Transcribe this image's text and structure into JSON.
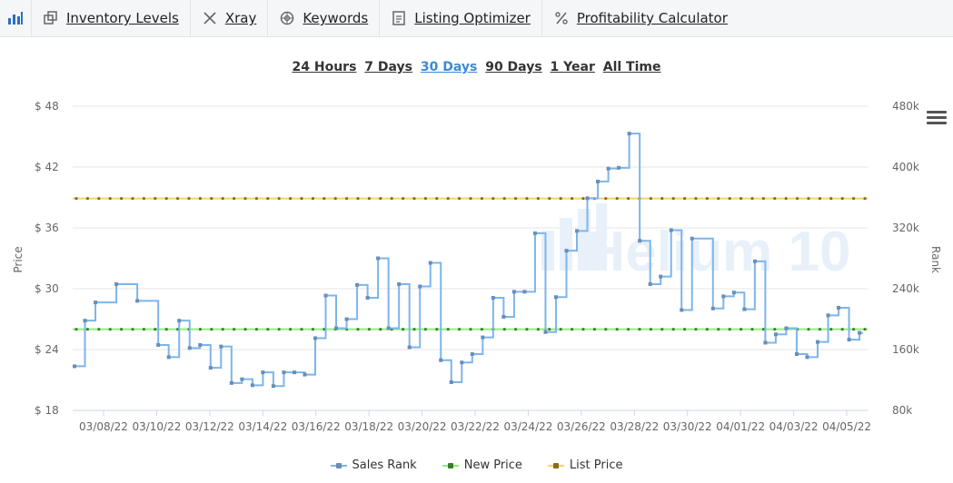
{
  "toolbar": {
    "items": [
      {
        "label": "Inventory Levels",
        "icon": "inventory-icon"
      },
      {
        "label": "Xray",
        "icon": "xray-icon"
      },
      {
        "label": "Keywords",
        "icon": "keywords-icon"
      },
      {
        "label": "Listing Optimizer",
        "icon": "listing-icon"
      },
      {
        "label": "Profitability Calculator",
        "icon": "percent-icon"
      }
    ]
  },
  "ranges": {
    "items": [
      "24 Hours",
      "7 Days",
      "30 Days",
      "90 Days",
      "1 Year",
      "All Time"
    ],
    "active": "30 Days"
  },
  "watermark": "Helium 10",
  "chart_data": {
    "type": "line",
    "y_left": {
      "label": "Price",
      "ticks": [
        "$ 18",
        "$ 24",
        "$ 30",
        "$ 36",
        "$ 42",
        "$ 48"
      ],
      "range": [
        18,
        48
      ]
    },
    "y_right": {
      "label": "Rank",
      "ticks": [
        "80k",
        "160k",
        "240k",
        "320k",
        "400k",
        "480k"
      ],
      "range": [
        80000,
        480000
      ]
    },
    "x_ticks": [
      "03/08/22",
      "03/10/22",
      "03/12/22",
      "03/14/22",
      "03/16/22",
      "03/18/22",
      "03/20/22",
      "03/22/22",
      "03/24/22",
      "03/26/22",
      "03/28/22",
      "03/30/22",
      "04/01/22",
      "04/03/22",
      "04/05/22"
    ],
    "x_range": [
      0,
      30
    ],
    "series": [
      {
        "name": "Sales Rank",
        "axis": "right",
        "step": true,
        "color": "#7cb5ec",
        "x": [
          0,
          0.5,
          1,
          2,
          3,
          4,
          4.5,
          5,
          5.5,
          6,
          6.5,
          7,
          7.5,
          8,
          8.5,
          9,
          9.5,
          10,
          10.5,
          11,
          11.5,
          12,
          12.5,
          13,
          13.5,
          14,
          14.5,
          15,
          15.5,
          16,
          16.5,
          17,
          17.5,
          18,
          18.5,
          19,
          19.5,
          20,
          20.5,
          21,
          21.5,
          22,
          22.5,
          23,
          23.5,
          24,
          24.5,
          25,
          25.5,
          26,
          26.5,
          27,
          27.5,
          28,
          28.5,
          29,
          29.5
        ],
        "values": [
          138000,
          198000,
          222000,
          246000,
          224000,
          166000,
          150000,
          198000,
          162000,
          166000,
          136000,
          164000,
          116000,
          121000,
          113000,
          130000,
          112000,
          130000,
          130000,
          127000,
          175000,
          231000,
          188000,
          200000,
          245000,
          228000,
          280000,
          188000,
          246000,
          163000,
          243000,
          274000,
          146000,
          117000,
          143000,
          154000,
          176000,
          228000,
          203000,
          236000,
          236000,
          313000,
          183000,
          229000,
          290000,
          316000,
          359000,
          381000,
          398000,
          399000,
          444000,
          303000,
          246000,
          256000,
          317000,
          212000,
          306000
        ],
        "values_tail": [
          214000,
          230000,
          235000,
          213000,
          276000,
          169000,
          180000,
          188000,
          154000,
          150000,
          170000,
          205000,
          215000,
          173000,
          182000
        ],
        "x_tail": [
          30.5,
          31,
          31.5,
          32,
          32.5,
          33,
          33.5,
          34,
          34.5,
          35,
          35.5,
          36,
          36.5,
          37,
          37.5
        ]
      },
      {
        "name": "New Price",
        "axis": "left",
        "color": "#90ed7d",
        "dot": "#3a7d2a",
        "constant": 26.0
      },
      {
        "name": "List Price",
        "axis": "left",
        "color": "#f7d46a",
        "dot": "#8a6d1c",
        "constant": 38.9
      }
    ]
  }
}
